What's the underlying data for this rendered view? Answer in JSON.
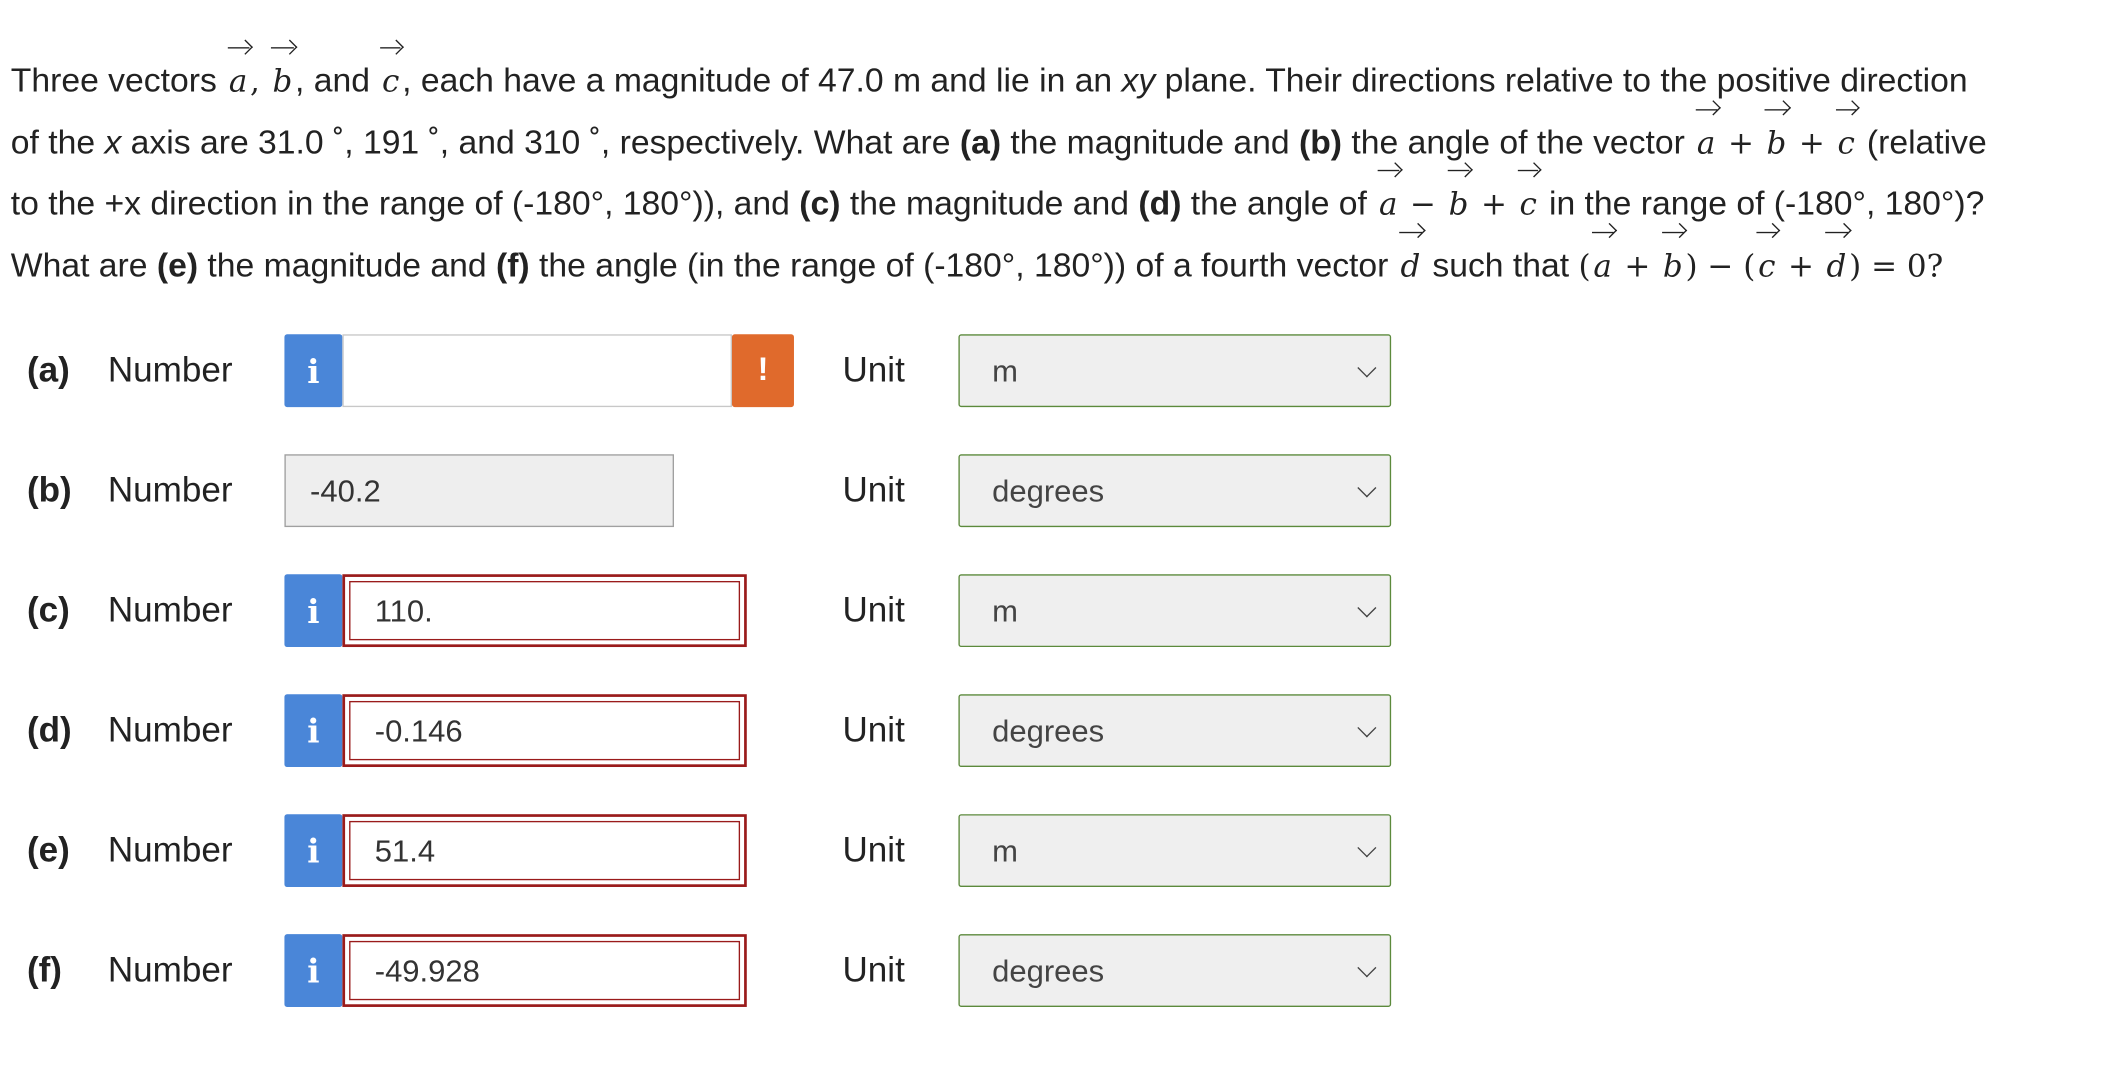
{
  "question": {
    "l1_a": "Three vectors ",
    "va": "a",
    "comma1": ", ",
    "vb": "b",
    "l1_b": ", and ",
    "vc": "c",
    "l1_c": ", each have a magnitude of 47.0 m and lie in an ",
    "xy": "xy",
    "l1_d": " plane. Their directions relative to the positive direction",
    "l2_a": "of the ",
    "x": "x",
    "l2_b": " axis are 31.0 ˚, 191 ˚, and 310 ˚, respectively. What are ",
    "pa": "(a)",
    "l2_c": " the magnitude and ",
    "pb": "(b)",
    "l2_d": " the angle of the vector ",
    "plus": " + ",
    "minus": " − ",
    "l2_e": " (relative",
    "l3_a": "to the +x direction in the range of (-180°, 180°)), and ",
    "pc": "(c)",
    "l3_b": " the magnitude and ",
    "pd": "(d)",
    "l3_c": " the angle of ",
    "l3_d": " in the range of (-180°, 180°)?",
    "l4_a": "What are ",
    "pe": "(e)",
    "l4_b": " the magnitude and ",
    "pf": "(f)",
    "l4_c": " the angle (in the range of (-180°, 180°)) of a fourth vector ",
    "vd": "d",
    "l4_d": " such that ",
    "lp": "(",
    "rp": ")",
    "eq0": " = 0?"
  },
  "rows": [
    {
      "tag": "(a)",
      "label": "Number",
      "value": "",
      "unit_label": "Unit",
      "unit": "m",
      "warn": "!"
    },
    {
      "tag": "(b)",
      "label": "Number",
      "value": "-40.2",
      "unit_label": "Unit",
      "unit": "degrees"
    },
    {
      "tag": "(c)",
      "label": "Number",
      "value": "110.",
      "unit_label": "Unit",
      "unit": "m"
    },
    {
      "tag": "(d)",
      "label": "Number",
      "value": "-0.146",
      "unit_label": "Unit",
      "unit": "degrees"
    },
    {
      "tag": "(e)",
      "label": "Number",
      "value": "51.4",
      "unit_label": "Unit",
      "unit": "m"
    },
    {
      "tag": "(f)",
      "label": "Number",
      "value": "-49.928",
      "unit_label": "Unit",
      "unit": "degrees"
    }
  ],
  "info_glyph": "i",
  "colors": {
    "info": "#4a86d8",
    "warning": "#e06a2c",
    "wrong_border": "#9a1b1b",
    "select_border": "#5c8a3c"
  }
}
